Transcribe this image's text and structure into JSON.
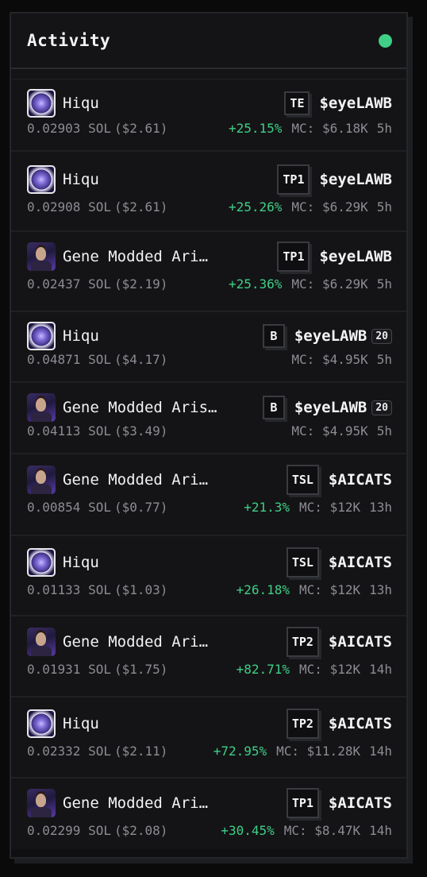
{
  "header": {
    "title": "Activity",
    "status_color": "#3fcf86"
  },
  "colors": {
    "positive": "#3fcf86",
    "muted": "#8c8d94"
  },
  "rows": [
    {
      "avatar": "hiqu-avatar",
      "name": "Hiqu",
      "tag": "TE",
      "token": "$eyeLAWB",
      "count": "",
      "sol": "0.02903 SOL",
      "usd": "($2.61)",
      "pct": "+25.15%",
      "mc": "MC: $6.18K",
      "age": "5h"
    },
    {
      "avatar": "hiqu-avatar",
      "name": "Hiqu",
      "tag": "TP1",
      "token": "$eyeLAWB",
      "count": "",
      "sol": "0.02908 SOL",
      "usd": "($2.61)",
      "pct": "+25.26%",
      "mc": "MC: $6.29K",
      "age": "5h"
    },
    {
      "avatar": "gene-avatar",
      "name": "Gene Modded Ari…",
      "tag": "TP1",
      "token": "$eyeLAWB",
      "count": "",
      "sol": "0.02437 SOL",
      "usd": "($2.19)",
      "pct": "+25.36%",
      "mc": "MC: $6.29K",
      "age": "5h"
    },
    {
      "avatar": "hiqu-avatar",
      "name": "Hiqu",
      "tag": "B",
      "token": "$eyeLAWB",
      "count": "20",
      "sol": "0.04871 SOL",
      "usd": "($4.17)",
      "pct": "",
      "mc": "MC: $4.95K",
      "age": "5h"
    },
    {
      "avatar": "gene-avatar",
      "name": "Gene Modded Aris…",
      "tag": "B",
      "token": "$eyeLAWB",
      "count": "20",
      "sol": "0.04113 SOL",
      "usd": "($3.49)",
      "pct": "",
      "mc": "MC: $4.95K",
      "age": "5h"
    },
    {
      "avatar": "gene-avatar",
      "name": "Gene Modded Ari…",
      "tag": "TSL",
      "token": "$AICATS",
      "count": "",
      "sol": "0.00854 SOL",
      "usd": "($0.77)",
      "pct": "+21.3%",
      "mc": "MC: $12K",
      "age": "13h"
    },
    {
      "avatar": "hiqu-avatar",
      "name": "Hiqu",
      "tag": "TSL",
      "token": "$AICATS",
      "count": "",
      "sol": "0.01133 SOL",
      "usd": "($1.03)",
      "pct": "+26.18%",
      "mc": "MC: $12K",
      "age": "13h"
    },
    {
      "avatar": "gene-avatar",
      "name": "Gene Modded Ari…",
      "tag": "TP2",
      "token": "$AICATS",
      "count": "",
      "sol": "0.01931 SOL",
      "usd": "($1.75)",
      "pct": "+82.71%",
      "mc": "MC: $12K",
      "age": "14h"
    },
    {
      "avatar": "hiqu-avatar",
      "name": "Hiqu",
      "tag": "TP2",
      "token": "$AICATS",
      "count": "",
      "sol": "0.02332 SOL",
      "usd": "($2.11)",
      "pct": "+72.95%",
      "mc": "MC: $11.28K",
      "age": "14h"
    },
    {
      "avatar": "gene-avatar",
      "name": "Gene Modded Ari…",
      "tag": "TP1",
      "token": "$AICATS",
      "count": "",
      "sol": "0.02299 SOL",
      "usd": "($2.08)",
      "pct": "+30.45%",
      "mc": "MC: $8.47K",
      "age": "14h"
    }
  ]
}
